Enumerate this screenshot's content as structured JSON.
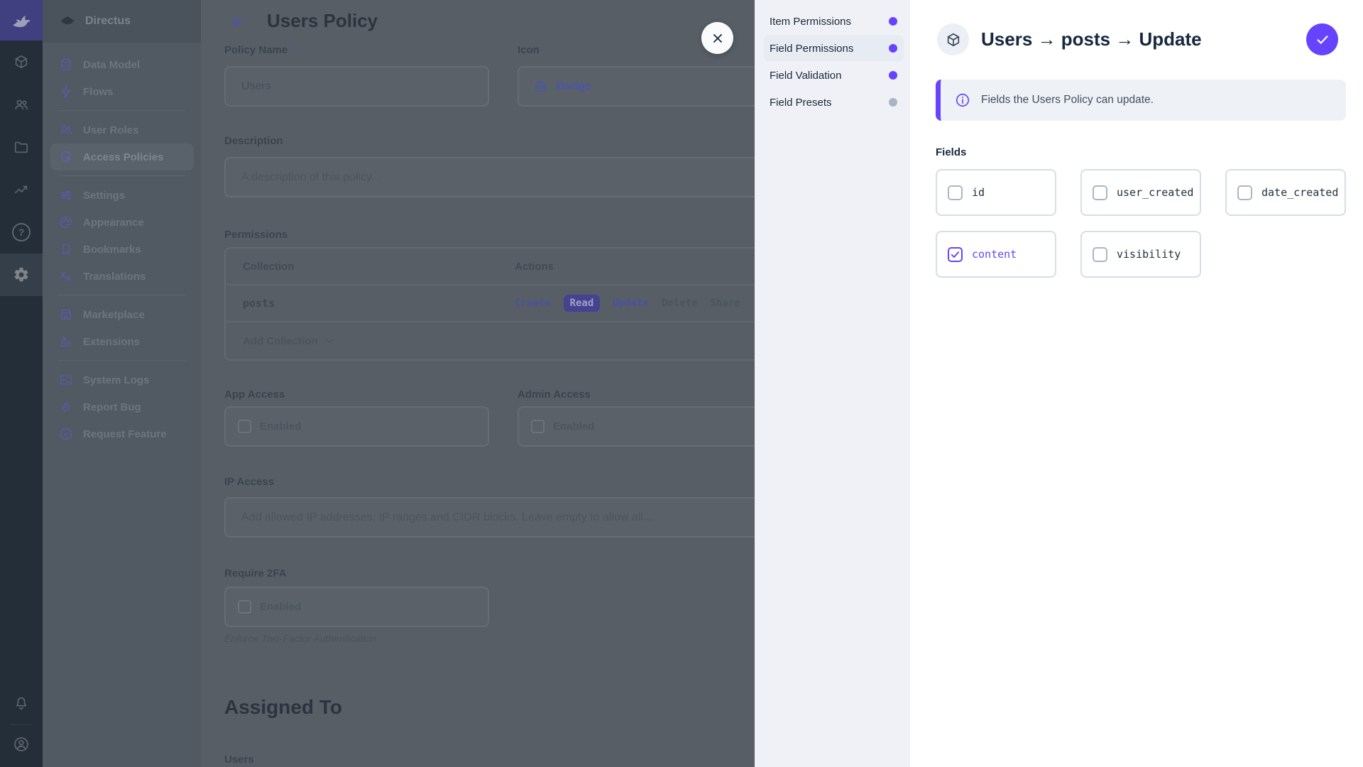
{
  "colors": {
    "accent": "#6644ff",
    "module_bar_bg": "#232e39",
    "logo_bg_dimmed": "#403f80",
    "nav_bg_dimmed": "#515963",
    "content_bg_dimmed": "#575e66",
    "drawer_panel_bg": "#eff1f6",
    "drawer_bg": "#ffffff",
    "notice_bg": "#eef1f6",
    "inactive_dot": "#a9b5c5"
  },
  "module_bar": {
    "logo": "directus-rabbit-logo",
    "modules": [
      {
        "name": "content",
        "icon": "box-icon"
      },
      {
        "name": "user-directory",
        "icon": "people-icon"
      },
      {
        "name": "file-library",
        "icon": "folder-icon"
      },
      {
        "name": "insights",
        "icon": "chart-icon"
      },
      {
        "name": "help",
        "icon": "help-icon",
        "glyph": "?"
      },
      {
        "name": "settings",
        "icon": "gear-icon",
        "active": true
      }
    ],
    "bottom": [
      {
        "name": "notifications",
        "icon": "bell-icon"
      },
      {
        "name": "account",
        "icon": "user-circle-icon"
      }
    ]
  },
  "nav": {
    "project_name": "Directus",
    "project_icon": "project-status-icon",
    "items": [
      {
        "label": "Data Model",
        "icon": "database-icon"
      },
      {
        "label": "Flows",
        "icon": "bolt-icon"
      },
      {
        "label": "User Roles",
        "icon": "people-icon"
      },
      {
        "label": "Access Policies",
        "icon": "shield-lock-icon",
        "active": true
      },
      {
        "label": "Settings",
        "icon": "tune-icon"
      },
      {
        "label": "Appearance",
        "icon": "palette-icon"
      },
      {
        "label": "Bookmarks",
        "icon": "bookmark-icon"
      },
      {
        "label": "Translations",
        "icon": "translate-icon"
      },
      {
        "label": "Marketplace",
        "icon": "storefront-icon"
      },
      {
        "label": "Extensions",
        "icon": "extension-icon"
      },
      {
        "label": "System Logs",
        "icon": "terminal-icon"
      },
      {
        "label": "Report Bug",
        "icon": "bug-icon"
      },
      {
        "label": "Request Feature",
        "icon": "verified-icon"
      }
    ]
  },
  "main": {
    "title": "Users Policy",
    "policy_name": {
      "label": "Policy Name",
      "required_mark": "*",
      "value": "Users"
    },
    "icon_field": {
      "label": "Icon",
      "value": "Badge",
      "icon": "badge-icon"
    },
    "description": {
      "label": "Description",
      "placeholder": "A description of this policy..."
    },
    "permissions": {
      "label": "Permissions",
      "columns": [
        "Collection",
        "Actions"
      ],
      "rows": [
        {
          "collection": "posts",
          "actions": [
            {
              "label": "Create",
              "state": "enabled"
            },
            {
              "label": "Read",
              "state": "active"
            },
            {
              "label": "Update",
              "state": "enabled"
            },
            {
              "label": "Delete",
              "state": "disabled"
            },
            {
              "label": "Share",
              "state": "disabled"
            }
          ]
        }
      ],
      "add_collection_label": "Add Collection"
    },
    "app_access": {
      "label": "App Access",
      "checkbox_label": "Enabled",
      "checked": false
    },
    "admin_access": {
      "label": "Admin Access",
      "checkbox_label": "Enabled",
      "checked": false
    },
    "ip_access": {
      "label": "IP Access",
      "placeholder": "Add allowed IP addresses, IP ranges and CIDR blocks. Leave empty to allow all..."
    },
    "require_2fa": {
      "label": "Require 2FA",
      "checkbox_label": "Enabled",
      "checked": false,
      "note": "Enforce Two-Factor Authentication"
    },
    "assigned_to": {
      "heading": "Assigned To",
      "users_label": "Users"
    }
  },
  "drawer": {
    "nav": [
      {
        "label": "Item Permissions",
        "dot_color": "purple",
        "active": false
      },
      {
        "label": "Field Permissions",
        "dot_color": "purple",
        "active": true
      },
      {
        "label": "Field Validation",
        "dot_color": "purple",
        "active": false
      },
      {
        "label": "Field Presets",
        "dot_color": "gray",
        "active": false
      }
    ],
    "header": {
      "title": "Users → posts → Update",
      "icon": "box-icon",
      "save_icon": "check-icon"
    },
    "notice": "Fields the Users Policy can update.",
    "fields_label": "Fields",
    "fields": [
      {
        "label": "id",
        "checked": false
      },
      {
        "label": "user_created",
        "checked": false
      },
      {
        "label": "date_created",
        "checked": false
      },
      {
        "label": "content",
        "checked": true
      },
      {
        "label": "visibility",
        "checked": false
      }
    ]
  }
}
